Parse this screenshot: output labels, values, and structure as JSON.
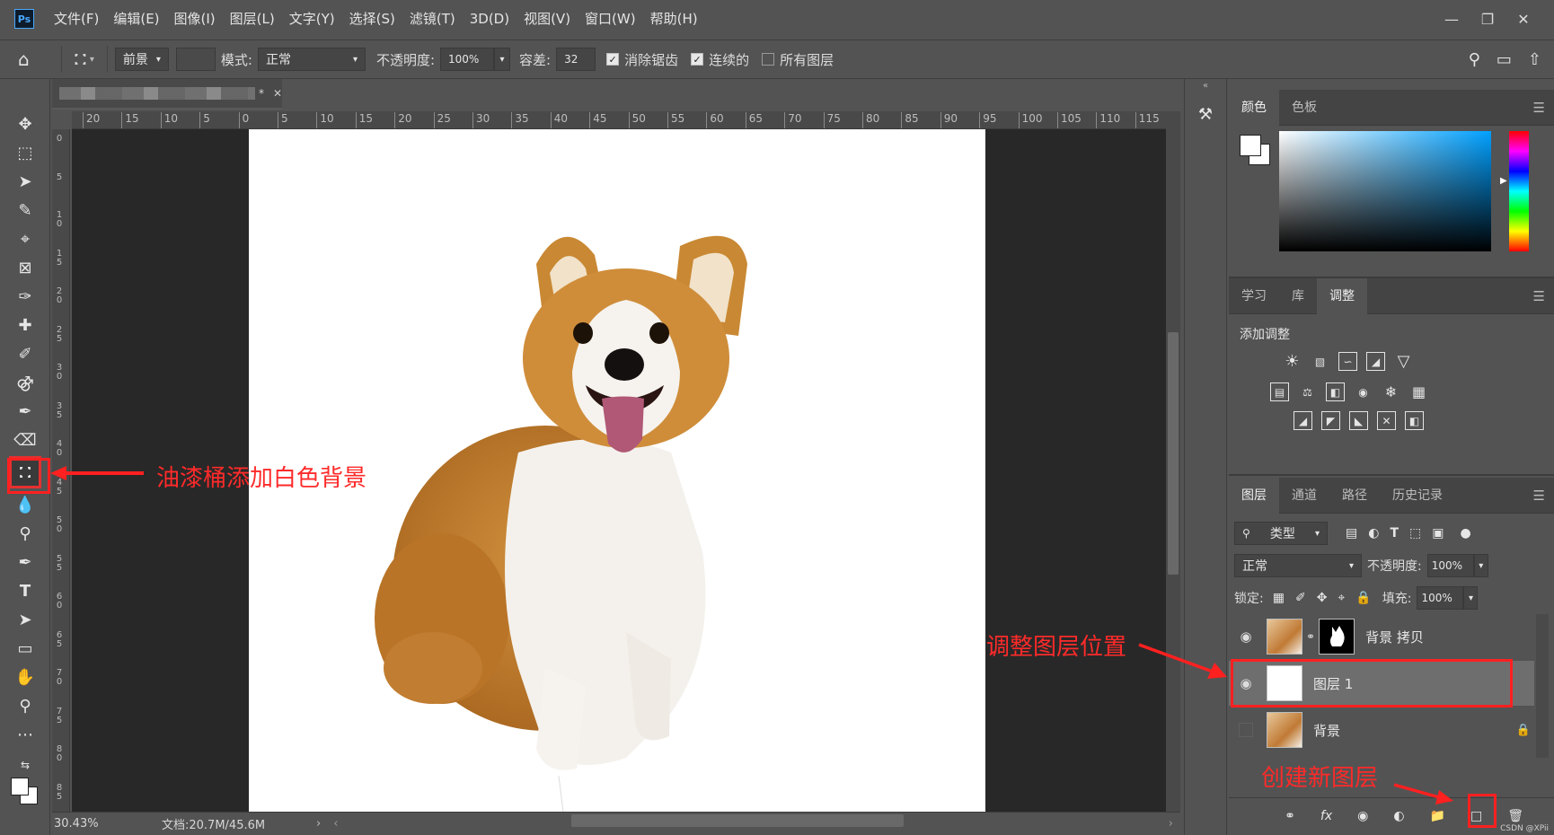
{
  "menu": [
    "文件(F)",
    "编辑(E)",
    "图像(I)",
    "图层(L)",
    "文字(Y)",
    "选择(S)",
    "滤镜(T)",
    "3D(D)",
    "视图(V)",
    "窗口(W)",
    "帮助(H)"
  ],
  "app": {
    "logo": "Ps"
  },
  "options": {
    "fill_source": "前景",
    "mode_label": "模式:",
    "mode_value": "正常",
    "opacity_label": "不透明度:",
    "opacity_value": "100%",
    "tolerance_label": "容差:",
    "tolerance_value": "32",
    "antialias_label": "消除锯齿",
    "contiguous_label": "连续的",
    "all_layers_label": "所有图层",
    "antialias_checked": true,
    "contiguous_checked": true,
    "all_layers_checked": false
  },
  "document": {
    "tab_suffix": "*",
    "ruler_top": [
      "20",
      "15",
      "10",
      "5",
      "0",
      "5",
      "10",
      "15",
      "20",
      "25",
      "30",
      "35",
      "40",
      "45",
      "50",
      "55",
      "60",
      "65",
      "70",
      "75",
      "80",
      "85",
      "90",
      "95",
      "100",
      "105",
      "110",
      "115"
    ],
    "ruler_left": [
      "0",
      "5",
      "10",
      "15",
      "20",
      "25",
      "30",
      "35",
      "40",
      "45",
      "50",
      "55",
      "60",
      "65",
      "70",
      "75",
      "80",
      "85"
    ],
    "zoom": "30.43%",
    "doc_size": "文档:20.7M/45.6M"
  },
  "annotations": {
    "paint_bucket": "油漆桶添加白色背景",
    "adjust_layer": "调整图层位置",
    "new_layer": "创建新图层"
  },
  "color_panel": {
    "tabs": [
      "颜色",
      "色板"
    ],
    "active": 0
  },
  "adjust_panel": {
    "tabs": [
      "学习",
      "库",
      "调整"
    ],
    "active": 2,
    "title": "添加调整"
  },
  "layers_panel": {
    "tabs": [
      "图层",
      "通道",
      "路径",
      "历史记录"
    ],
    "active": 0,
    "filter_kind": "类型",
    "blend_mode": "正常",
    "opacity_label": "不透明度:",
    "opacity_value": "100%",
    "lock_label": "锁定:",
    "fill_label": "填充:",
    "fill_value": "100%",
    "layers": [
      {
        "name": "背景 拷贝",
        "visible": true,
        "selected": false
      },
      {
        "name": "图层 1",
        "visible": true,
        "selected": true
      },
      {
        "name": "背景",
        "visible": false,
        "selected": false
      }
    ]
  },
  "watermark": "CSDN @XPii"
}
